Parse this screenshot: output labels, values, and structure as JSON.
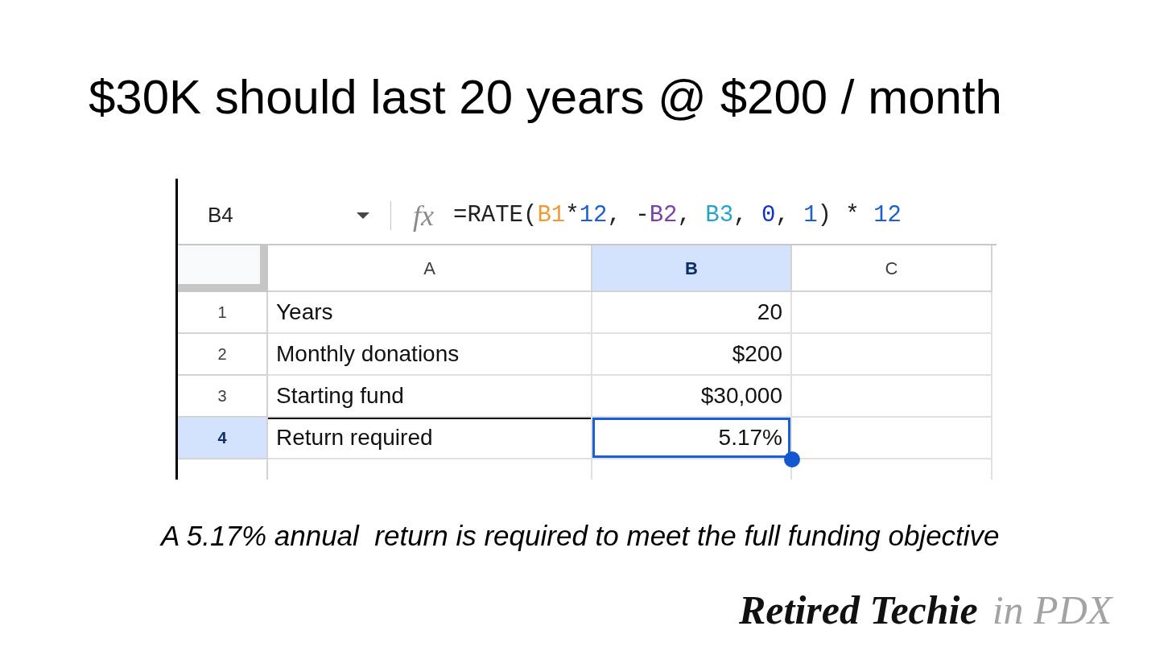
{
  "title": "$30K should last 20 years @ $200 / month",
  "sheet": {
    "name_box": "B4",
    "function_label": "fx",
    "formula": [
      {
        "text": "=RATE(",
        "color": "#202124"
      },
      {
        "text": "B1",
        "color": "#f09a36"
      },
      {
        "text": "*",
        "color": "#202124"
      },
      {
        "text": "12",
        "color": "#1b5fd2"
      },
      {
        "text": ", -",
        "color": "#202124"
      },
      {
        "text": "B2",
        "color": "#7d3fa9"
      },
      {
        "text": ", ",
        "color": "#202124"
      },
      {
        "text": "B3",
        "color": "#27a3c9"
      },
      {
        "text": ", ",
        "color": "#202124"
      },
      {
        "text": "0",
        "color": "#0d34c8"
      },
      {
        "text": ", ",
        "color": "#202124"
      },
      {
        "text": "1",
        "color": "#1b5fd2"
      },
      {
        "text": ") * ",
        "color": "#202124"
      },
      {
        "text": "12",
        "color": "#1b5fd2"
      }
    ],
    "columns": [
      {
        "label": "A",
        "selected": false
      },
      {
        "label": "B",
        "selected": true
      },
      {
        "label": "C",
        "selected": false
      }
    ],
    "rows": [
      {
        "number": "1",
        "selected": false,
        "top_rule": false,
        "cells": [
          "Years",
          "20"
        ]
      },
      {
        "number": "2",
        "selected": false,
        "top_rule": false,
        "cells": [
          "Monthly donations",
          "$200"
        ]
      },
      {
        "number": "3",
        "selected": false,
        "top_rule": false,
        "cells": [
          "Starting fund",
          "$30,000"
        ]
      },
      {
        "number": "4",
        "selected": true,
        "top_rule": true,
        "cells": [
          "Return required",
          "5.17%"
        ]
      }
    ]
  },
  "caption": "A 5.17% annual  return is required to meet the full funding objective",
  "logo": {
    "name": "Retired Techie",
    "suffix": "in PDX"
  }
}
